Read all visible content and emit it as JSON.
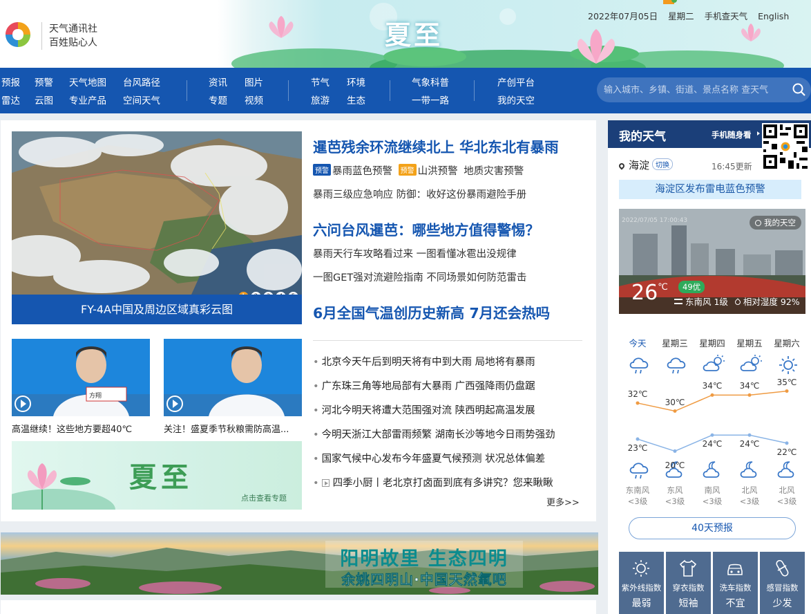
{
  "header": {
    "brand_line1": "天气通讯社",
    "brand_line2": "百姓贴心人",
    "banner_title": "夏至",
    "date": "2022年07月05日",
    "weekday": "星期二",
    "mobile": "手机查天气",
    "english": "English"
  },
  "nav": {
    "group1": [
      "预报",
      "预警",
      "天气地图",
      "台风路径",
      "雷达",
      "云图",
      "专业产品",
      "空间天气"
    ],
    "group2": [
      "资讯",
      "图片",
      "专题",
      "视频"
    ],
    "group3": [
      "节气",
      "环境",
      "旅游",
      "生态"
    ],
    "group4": [
      "气象科普",
      "一带一路"
    ],
    "group5": [
      "产创平台",
      "我的天空"
    ],
    "search_placeholder": "输入城市、乡镇、街道、景点名称 查天气"
  },
  "feature": {
    "caption": "FY-4A中国及周边区域真彩云图",
    "dots": [
      "1",
      "2",
      "3",
      "4",
      "5"
    ],
    "video1": "高温继续！这些地方要超40℃",
    "video2": "关注！盛夏季节秋粮需防高温...",
    "xiazhi_title": "夏至",
    "xiazhi_link": "点击查看专题",
    "video_sub": "方翔"
  },
  "headlines": {
    "h1": "暹芭残余环流继续北上 华北东北有暴雨",
    "tag1": "预警",
    "w1": "暴雨蓝色预警",
    "tag2": "预警",
    "w2": "山洪预警",
    "w3": "地质灾害预警",
    "s2": "暴雨三级应急响应 防御：收好这份暴雨避险手册",
    "h2": "六问台风暹芭：哪些地方值得警惕？",
    "s3": "暴雨天行车攻略看过来 一图看懂冰雹出没规律",
    "s4": "一图GET强对流避险指南 不同场景如何防范雷击",
    "h3": "6月全国气温创历史新高 7月还会热吗"
  },
  "news": [
    "北京今天午后到明天将有中到大雨 局地将有暴雨",
    "广东珠三角等地局部有大暴雨  广西强降雨仍盘踞",
    "河北今明天将遭大范围强对流  陕西明起高温发展",
    "今明天浙江大部雷雨频繁  湖南长沙等地今日雨势强劲",
    "国家气候中心发布今年盛夏气候预测 状况总体偏差",
    "四季小厨丨老北京打卤面到底有多讲究？您来瞅瞅"
  ],
  "more": "更多>>",
  "promo": {
    "line1": "阳明故里 生态四明",
    "line2": "余姚四明山·中国天然氧吧"
  },
  "side": {
    "title": "我的天气",
    "mobile": "手机随身看",
    "location": "海淀",
    "switch": "切换",
    "updated": "16:45更新",
    "alert": "海淀区发布雷电蓝色预警",
    "photo_badge": "我的天空",
    "photo_time": "2022/07/05 17:00:43",
    "temp": "26",
    "temp_unit": "℃",
    "aqi": "49优",
    "wind": "东南风 1级",
    "humidity": "相对湿度 92%",
    "forty_day": "40天预报"
  },
  "forecast": {
    "days": [
      "今天",
      "星期三",
      "星期四",
      "星期五",
      "星期六"
    ],
    "day_icons": [
      "rain-cloud-icon",
      "rain-cloud-icon",
      "partly-sunny-icon",
      "partly-sunny-icon",
      "sun-icon"
    ],
    "high": [
      "32℃",
      "30℃",
      "34℃",
      "34℃",
      "35℃"
    ],
    "low": [
      "23℃",
      "20℃",
      "24℃",
      "24℃",
      "22℃"
    ],
    "high_values": [
      32,
      30,
      34,
      34,
      35
    ],
    "low_values": [
      23,
      20,
      24,
      24,
      22
    ],
    "night_icons": [
      "rain-cloud-icon",
      "night-cloud-icon",
      "night-cloud-icon",
      "night-cloud-icon",
      "night-cloud-icon"
    ],
    "wind_dir": [
      "东南风",
      "东风",
      "南风",
      "北风",
      "北风"
    ],
    "wind_lvl": [
      "<3级",
      "<3级",
      "<3级",
      "<3级",
      "<3级"
    ]
  },
  "indices": [
    {
      "name": "紫外线指数",
      "value": "最弱",
      "icon": "uv-icon"
    },
    {
      "name": "穿衣指数",
      "value": "短袖",
      "icon": "shirt-icon"
    },
    {
      "name": "洗车指数",
      "value": "不宜",
      "icon": "car-icon"
    },
    {
      "name": "感冒指数",
      "value": "少发",
      "icon": "pill-icon"
    }
  ]
}
